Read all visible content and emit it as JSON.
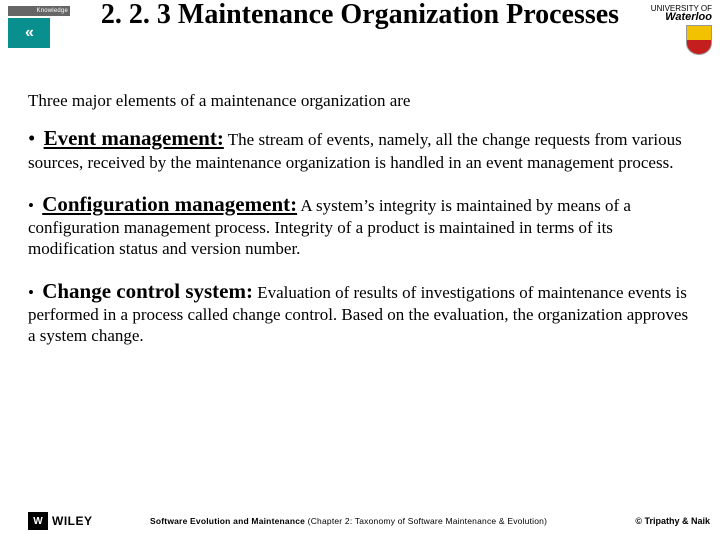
{
  "header": {
    "logo_left_top": "Knowledge",
    "logo_right_uni": "UNIVERSITY OF",
    "logo_right_name": "Waterloo",
    "title": "2. 2. 3 Maintenance Organization Processes"
  },
  "body": {
    "intro": "Three major elements of a maintenance organization are",
    "items": [
      {
        "lead": "Event management:",
        "underline": true,
        "big_bullet": true,
        "desc": " The stream of events, namely, all the change requests from various sources, received by the maintenance organization is handled in an event management process."
      },
      {
        "lead": "Configuration management:",
        "underline": true,
        "big_bullet": false,
        "desc": " A system’s integrity is maintained by means of a configuration management process. Integrity of a product is maintained in terms of its modification status and version number."
      },
      {
        "lead": "Change control system:",
        "underline": false,
        "big_bullet": false,
        "desc": " Evaluation of results of investigations of maintenance events is performed in a process called change control. Based on the evaluation, the organization approves a system change."
      }
    ]
  },
  "footer": {
    "wiley": "WILEY",
    "center_bold": "Software Evolution and Maintenance",
    "center_rest": "  (Chapter 2: Taxonomy of Software Maintenance & Evolution)",
    "copyright": "© Tripathy & Naik"
  }
}
